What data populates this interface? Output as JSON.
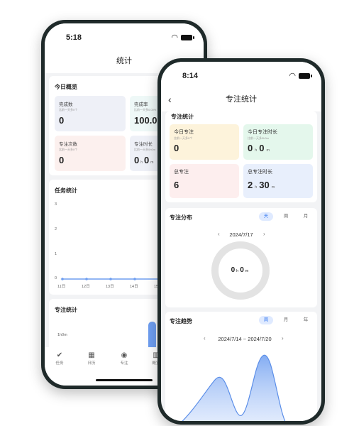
{
  "back_screen": {
    "time": "5:18",
    "nav_title": "统计",
    "overview": {
      "title": "今日概览",
      "tiles": [
        {
          "label": "完成数",
          "sub": "比前一天多0个",
          "value": "0",
          "unit": "",
          "bg": "#eef0f7"
        },
        {
          "label": "完成率",
          "sub": "比前一天多0.00%",
          "value": "100.0",
          "unit": "",
          "bg": "#eef8f7"
        },
        {
          "label": "专注次数",
          "sub": "比前一天多0个",
          "value": "0",
          "unit": "",
          "bg": "#fcf0ee"
        },
        {
          "label": "专注时长",
          "sub": "比前一天多0h0m",
          "value_h": "0",
          "unit_h": "h",
          "value_m": "0",
          "unit_m": "m",
          "bg": "#eef0f7"
        }
      ]
    },
    "task_stats": {
      "title": "任务统计",
      "y_ticks": [
        "3",
        "2",
        "1",
        "0"
      ],
      "x_ticks": [
        "11日",
        "12日",
        "13日",
        "14日",
        "15日"
      ]
    },
    "focus_stats": {
      "title": "专注统计",
      "y_label": "1h0m"
    },
    "tabs": [
      {
        "icon": "✔",
        "label": "任务"
      },
      {
        "icon": "▦",
        "label": "日历"
      },
      {
        "icon": "◉",
        "label": "专注"
      },
      {
        "icon": "▥",
        "label": "概览"
      }
    ]
  },
  "front_screen": {
    "time": "8:14",
    "nav_title": "专注统计",
    "stats": {
      "title": "专注统计",
      "tiles": [
        {
          "label": "今日专注",
          "sub": "比前一天多0个",
          "value": "0",
          "bg": "#fdf3db"
        },
        {
          "label": "今日专注时长",
          "sub": "比前一天多0h0m",
          "value_h": "0",
          "unit_h": "h",
          "value_m": "0",
          "unit_m": "m",
          "bg": "#e4f7ec"
        },
        {
          "label": "总专注",
          "value": "6",
          "bg": "#fdeeee"
        },
        {
          "label": "总专注时长",
          "value_h": "2",
          "unit_h": "h",
          "value_m": "30",
          "unit_m": "m",
          "bg": "#e8effc"
        }
      ]
    },
    "distribution": {
      "title": "专注分布",
      "segments": [
        "天",
        "周",
        "月"
      ],
      "active": 0,
      "date": "2024/7/17",
      "center_h": "0",
      "center_h_unit": "h",
      "center_m": "0",
      "center_m_unit": "m"
    },
    "trend": {
      "title": "专注趋势",
      "segments": [
        "周",
        "月",
        "年"
      ],
      "active": 0,
      "range": "2024/7/14 ~ 2024/7/20"
    }
  }
}
